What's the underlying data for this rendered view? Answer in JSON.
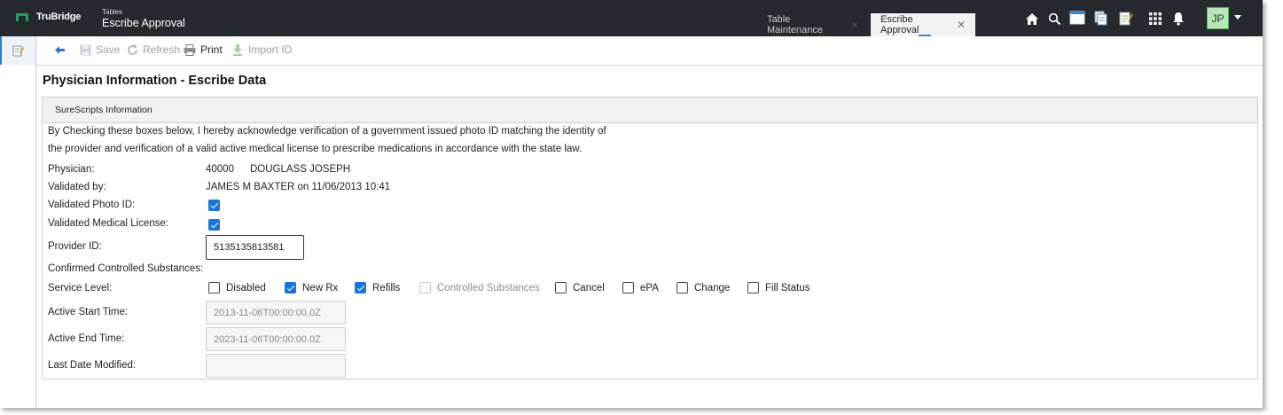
{
  "app": {
    "logo_text": "TruBridge",
    "section": "Tables",
    "name": "Escribe Approval"
  },
  "tabs": [
    {
      "label": "Table Maintenance",
      "close": "✕",
      "active": false
    },
    {
      "label": "Escribe Approval",
      "close": "✕",
      "active": true
    }
  ],
  "top_icons": [
    "home-icon",
    "search-icon",
    "window-icon",
    "documents-icon",
    "notepad-icon",
    "apps-grid-icon",
    "bell-icon"
  ],
  "user": {
    "initials": "JP"
  },
  "toolbar": {
    "back_icon": "back-arrow-icon",
    "save_label": "Save",
    "refresh_label": "Refresh",
    "print_label": "Print",
    "import_label": "Import ID"
  },
  "page": {
    "title": "Physician Information - Escribe Data"
  },
  "panel": {
    "header": "SureScripts Information",
    "intro_line1": "By Checking these boxes below, I hereby acknowledge verification of a government issued photo ID matching the identity of",
    "intro_line2": "the provider and verification of a valid active medical license to prescribe medications in accordance with the state law.",
    "physician_label": "Physician:",
    "physician_id": "40000",
    "physician_name": "DOUGLASS JOSEPH",
    "validated_by_label": "Validated by:",
    "validated_by_value": "JAMES M BAXTER on 11/06/2013 10:41",
    "photo_id_label": "Validated Photo ID:",
    "photo_id_checked": true,
    "license_label": "Validated Medical License:",
    "license_checked": true,
    "provider_id_label": "Provider ID:",
    "provider_id_value": "5135135813581",
    "controlled_label": "Confirmed Controlled Substances:",
    "service_level_label": "Service Level:",
    "service_levels": [
      {
        "label": "Disabled",
        "checked": false,
        "disabled": false
      },
      {
        "label": "New Rx",
        "checked": true,
        "disabled": false
      },
      {
        "label": "Refills",
        "checked": true,
        "disabled": false
      },
      {
        "label": "Controlled Substances",
        "checked": false,
        "disabled": true
      },
      {
        "label": "Cancel",
        "checked": false,
        "disabled": false
      },
      {
        "label": "ePA",
        "checked": false,
        "disabled": false
      },
      {
        "label": "Change",
        "checked": false,
        "disabled": false
      },
      {
        "label": "Fill Status",
        "checked": false,
        "disabled": false
      }
    ],
    "start_time_label": "Active Start Time:",
    "start_time_value": "2013-11-06T00:00:00.0Z",
    "end_time_label": "Active End Time:",
    "end_time_value": "2023-11-06T00:00:00.0Z",
    "last_modified_label": "Last Date Modified:",
    "last_modified_value": ""
  },
  "colors": {
    "topbar": "#262a2e",
    "brand_green": "#1fa35a",
    "checkbox_blue": "#1a73d9",
    "tab_accent": "#2f8fd8",
    "avatar_bg": "#b7e6b7"
  }
}
